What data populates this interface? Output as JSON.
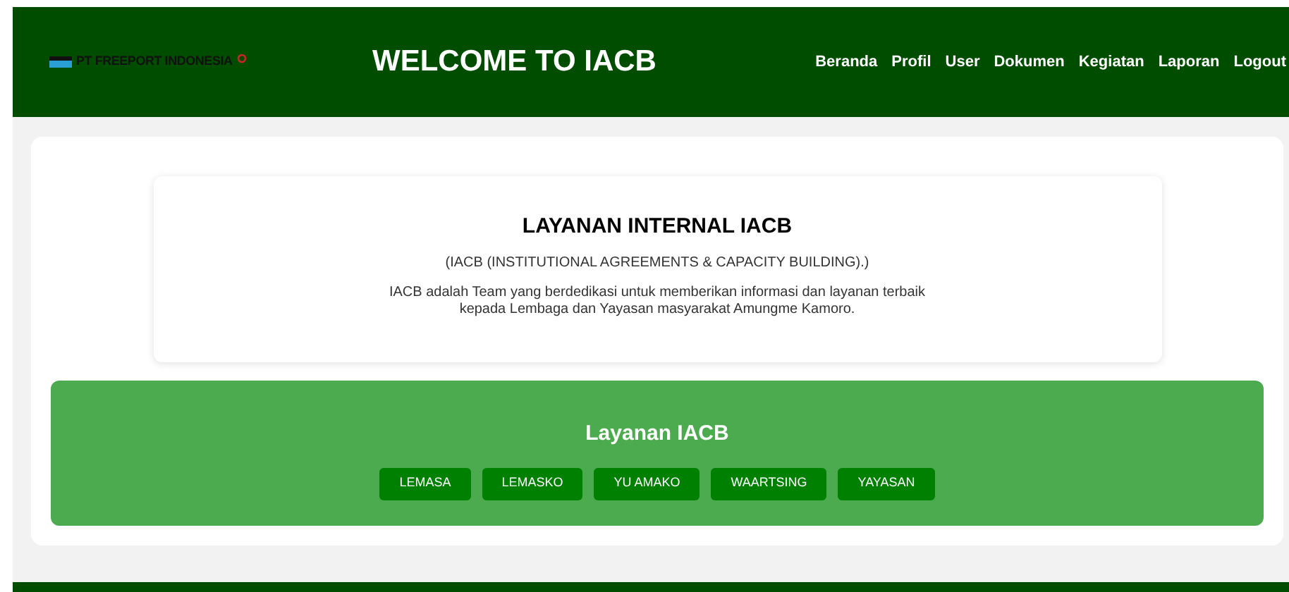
{
  "header": {
    "logo_text": "PT FREEPORT INDONESIA",
    "title": "WELCOME TO IACB",
    "nav": [
      "Beranda",
      "Profil",
      "User",
      "Dokumen",
      "Kegiatan",
      "Laporan",
      "Logout"
    ]
  },
  "intro": {
    "title": "LAYANAN INTERNAL IACB",
    "subtitle": "(IACB (INSTITUTIONAL AGREEMENTS & CAPACITY BUILDING).)",
    "description": "IACB adalah Team yang berdedikasi untuk memberikan informasi dan layanan terbaik kepada Lembaga dan Yayasan masyarakat Amungme Kamoro."
  },
  "services": {
    "title": "Layanan IACB",
    "buttons": [
      "LEMASA",
      "LEMASKO",
      "YU AMAKO",
      "WAARTSING",
      "YAYASAN"
    ]
  }
}
